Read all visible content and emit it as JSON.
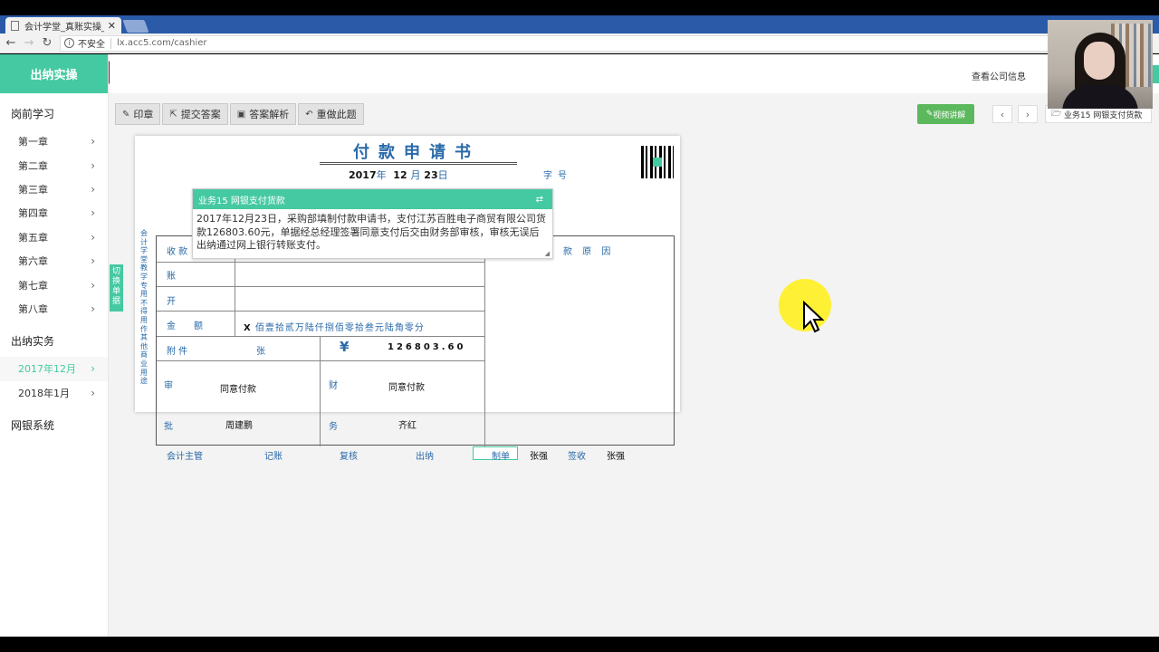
{
  "browser": {
    "tab_title": "会计学堂_真账实操_出纳",
    "tab_close": "✕",
    "security_label": "不安全",
    "url": "lx.acc5.com/cashier"
  },
  "sidebar": {
    "brand": "出纳实操",
    "sections": [
      {
        "title": "岗前学习",
        "items": [
          "第一章",
          "第二章",
          "第三章",
          "第四章",
          "第五章",
          "第六章",
          "第七章",
          "第八章"
        ]
      },
      {
        "title": "出纳实务",
        "items": [
          "2017年12月",
          "2018年1月"
        ]
      },
      {
        "title": "网银系统",
        "items": []
      }
    ],
    "active_item": "2017年12月",
    "switch_tab_label": "切换单据"
  },
  "header": {
    "company_link": "查看公司信息"
  },
  "toolbar": {
    "stamp": "印章",
    "submit": "提交答案",
    "analysis": "答案解析",
    "redo": "重做此题",
    "video": "视频讲解",
    "prev": "‹",
    "next": "›",
    "task_select": "业务15 网银支付货款"
  },
  "form": {
    "title": "付款申请书",
    "date": {
      "year": "2017",
      "year_unit": "年",
      "month": "12",
      "month_unit": "月",
      "day": "23",
      "day_unit": "日"
    },
    "zihao_label": "字号",
    "side_note": "会计学堂教学专用不得用作其他商业用途",
    "labels": {
      "payee": "收 款",
      "account": "账",
      "bank": "开",
      "reason": "款 原 因",
      "amount": "金　　额",
      "attachment": "附 件",
      "zhang": "张",
      "shen": "审",
      "pi": "批",
      "cai": "财",
      "wu": "务"
    },
    "amount_prefix": "X",
    "amount_words": "佰壹拾贰万陆仟捌佰零拾叁元陆角零分",
    "currency_symbol": "¥",
    "amount_number": "126803.60",
    "approval_text": "同意付款",
    "approver": "周建鹏",
    "finance_text": "同意付款",
    "finance_person": "齐红",
    "footer": {
      "supervisor": "会计主管",
      "bookkeeping": "记账",
      "review": "复核",
      "cashier": "出纳",
      "preparer_label": "制单",
      "preparer": "张强",
      "signer_label": "签收",
      "signer": "张强"
    }
  },
  "task_popup": {
    "title": "业务15 网银支付货款",
    "body": "2017年12月23日，采购部填制付款申请书，支付江苏百胜电子商贸有限公司货款126803.60元，单据经总经理签署同意支付后交由财务部审核，审核无误后出纳通过网上银行转账支付。"
  },
  "colors": {
    "accent": "#45c9a2",
    "form_blue": "#2a6aa8",
    "video_green": "#5cb85c"
  }
}
